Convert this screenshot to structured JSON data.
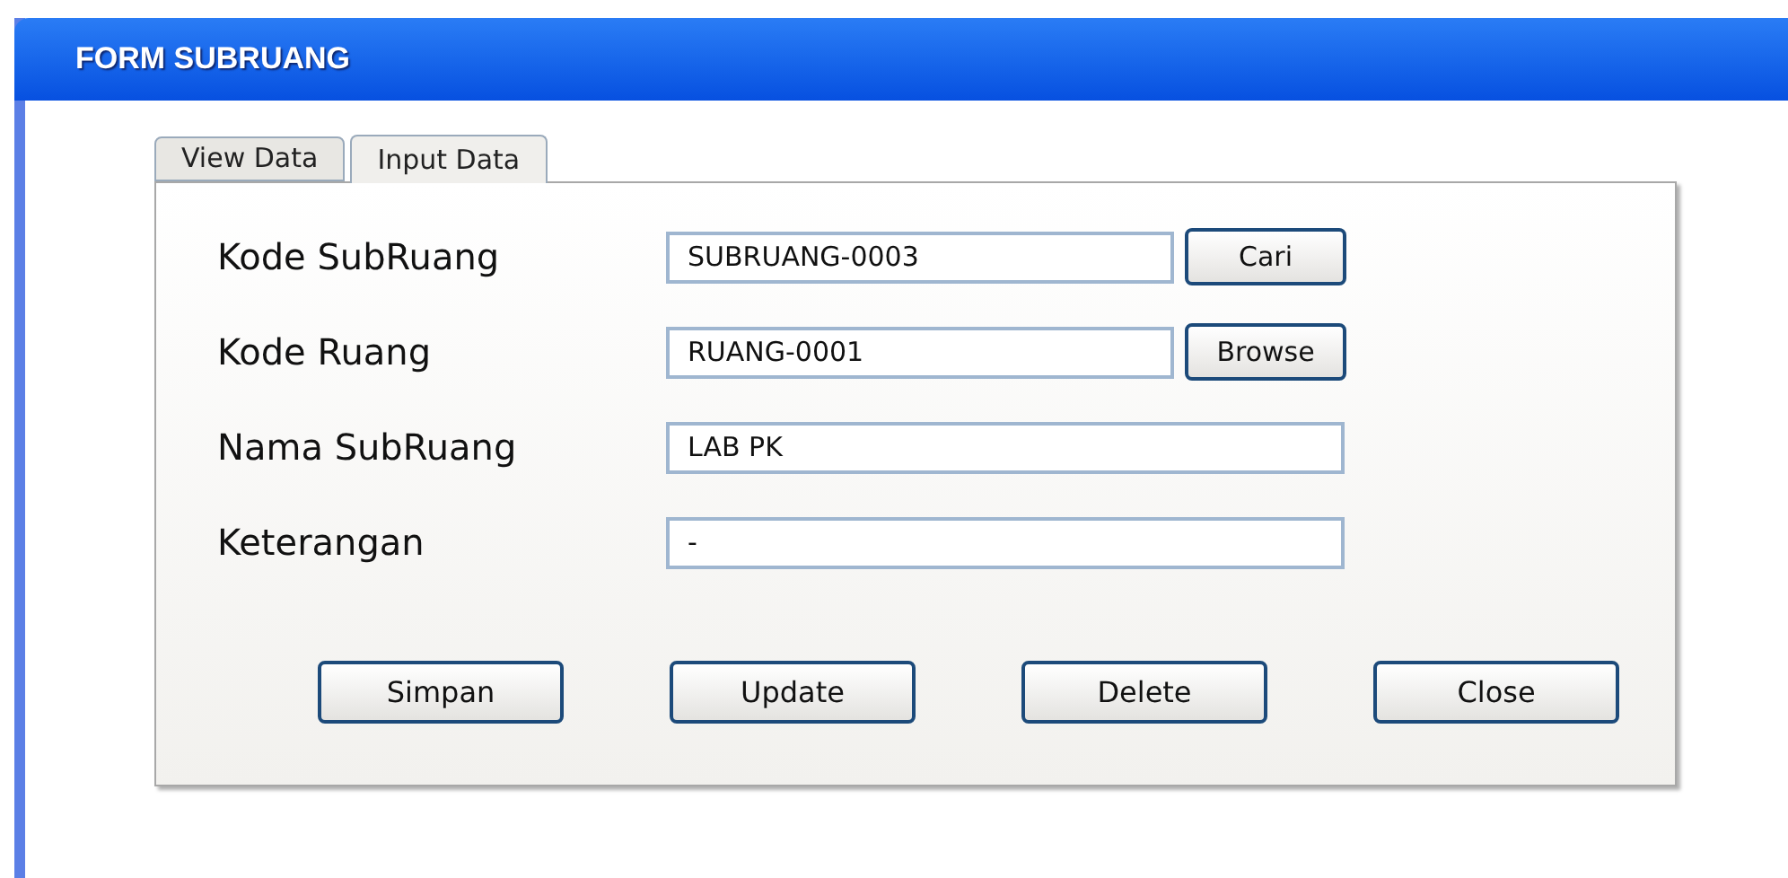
{
  "window": {
    "title": "FORM SUBRUANG"
  },
  "tabs": [
    {
      "label": "View Data",
      "selected": false
    },
    {
      "label": "Input Data",
      "selected": true
    }
  ],
  "fields": [
    {
      "label": "Kode SubRuang",
      "value": "SUBRUANG-0003",
      "button": "Cari"
    },
    {
      "label": "Kode Ruang",
      "value": "RUANG-0001",
      "button": "Browse"
    },
    {
      "label": "Nama SubRuang",
      "value": "LAB PK"
    },
    {
      "label": "Keterangan",
      "value": "-"
    }
  ],
  "buttons": [
    "Simpan",
    "Update",
    "Delete",
    "Close"
  ]
}
